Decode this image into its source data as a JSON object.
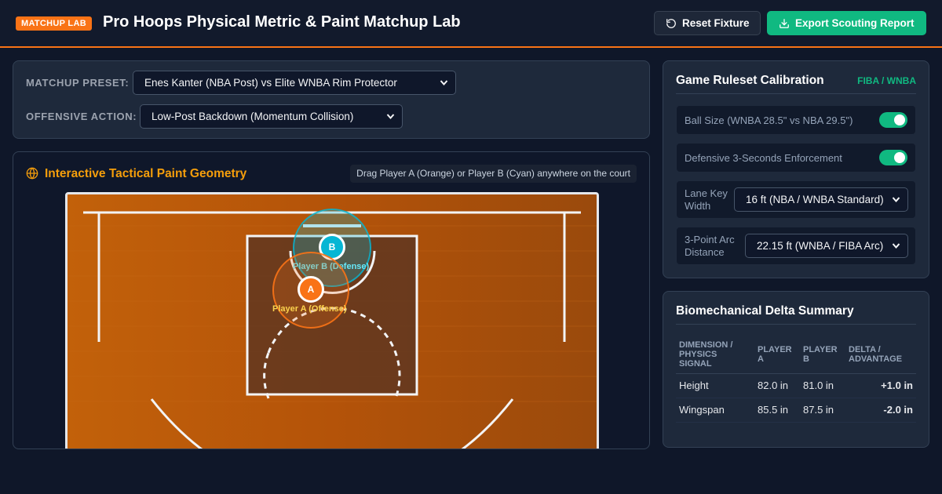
{
  "header": {
    "badge": "MATCHUP LAB",
    "title": "Pro Hoops Physical Metric & Paint Matchup Lab",
    "reset_label": "Reset Fixture",
    "export_label": "Export Scouting Report"
  },
  "controls": {
    "preset_label": "MATCHUP PRESET:",
    "preset_value": "Enes Kanter (NBA Post) vs Elite WNBA Rim Protector",
    "action_label": "OFFENSIVE ACTION:",
    "action_value": "Low-Post Backdown (Momentum Collision)"
  },
  "court": {
    "title": "Interactive Tactical Paint Geometry",
    "hint": "Drag Player A (Orange) or Player B (Cyan) anywhere on the court",
    "player_a": {
      "marker": "A",
      "label": "Player A (Offense)",
      "color": "#f97316"
    },
    "player_b": {
      "marker": "B",
      "label": "Player B (Defense)",
      "color": "#06b6d4"
    }
  },
  "rules": {
    "title": "Game Ruleset Calibration",
    "tag": "FIBA / WNBA",
    "ball_size_label": "Ball Size (WNBA 28.5\" vs NBA 29.5\")",
    "ball_size_on": true,
    "def3_label": "Defensive 3-Seconds Enforcement",
    "def3_on": true,
    "lane_label": "Lane Key Width",
    "lane_value": "16 ft (NBA / WNBA Standard)",
    "arc_label": "3-Point Arc Distance",
    "arc_value": "22.15 ft (WNBA / FIBA Arc)"
  },
  "delta": {
    "title": "Biomechanical Delta Summary",
    "headers": [
      "DIMENSION / PHYSICS SIGNAL",
      "PLAYER A",
      "PLAYER B",
      "DELTA / ADVANTAGE"
    ],
    "rows": [
      {
        "dimension": "Height",
        "a": "82.0 in",
        "b": "81.0 in",
        "delta": "+1.0 in",
        "sign": "pos"
      },
      {
        "dimension": "Wingspan",
        "a": "85.5 in",
        "b": "87.5 in",
        "delta": "-2.0 in",
        "sign": "neg"
      }
    ]
  },
  "colors": {
    "accent_orange": "#f97316",
    "accent_green": "#10b981",
    "accent_cyan": "#06b6d4",
    "court_wood": "#b45309"
  }
}
